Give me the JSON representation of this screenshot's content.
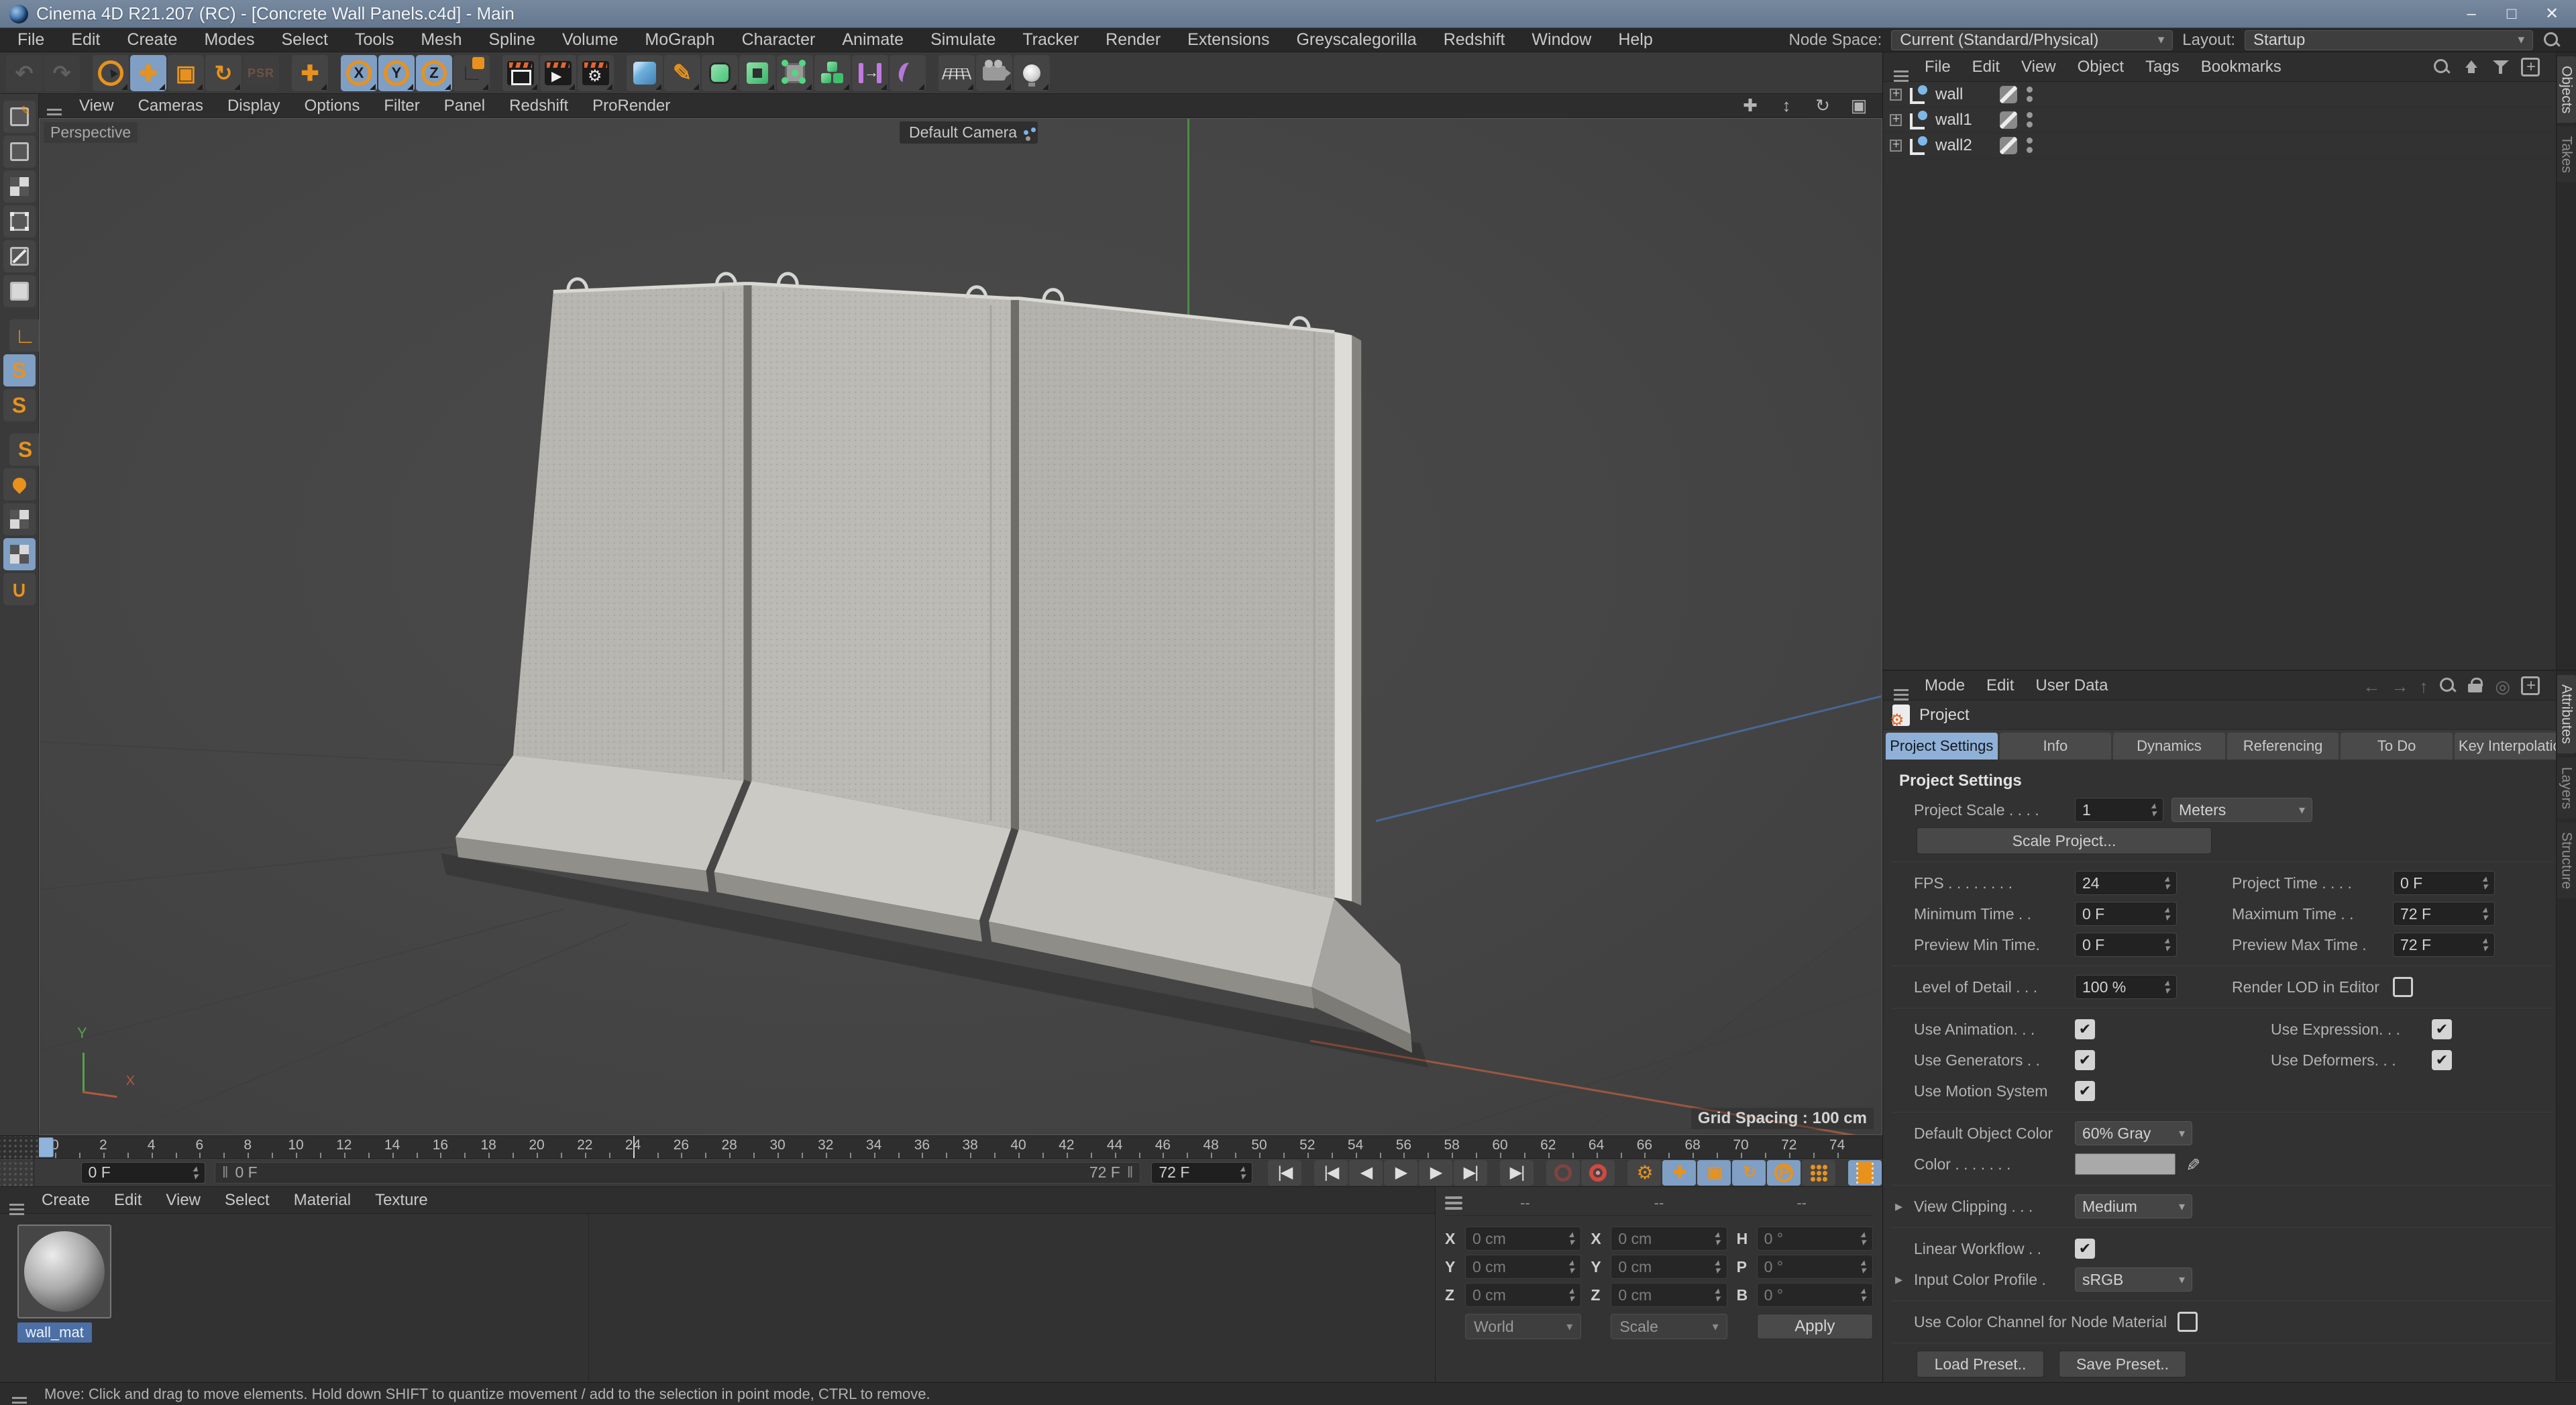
{
  "window": {
    "title": "Cinema 4D R21.207 (RC) - [Concrete Wall Panels.c4d] - Main",
    "minimize": "–",
    "maximize": "□",
    "close": "✕"
  },
  "menubar": {
    "items": [
      "File",
      "Edit",
      "Create",
      "Modes",
      "Select",
      "Tools",
      "Mesh",
      "Spline",
      "Volume",
      "MoGraph",
      "Character",
      "Animate",
      "Simulate",
      "Tracker",
      "Render",
      "Extensions",
      "Greyscalegorilla",
      "Redshift",
      "Window",
      "Help"
    ],
    "node_space_label": "Node Space:",
    "node_space_value": "Current (Standard/Physical)",
    "layout_label": "Layout:",
    "layout_value": "Startup"
  },
  "toolbar": {
    "tools": [
      {
        "name": "undo",
        "icon": "undo-icon",
        "dim": true
      },
      {
        "name": "redo",
        "icon": "redo-icon",
        "dim": true
      },
      {
        "name": "live-selection",
        "icon": "cursor-icon",
        "gap": true
      },
      {
        "name": "move",
        "icon": "move-icon",
        "active": true
      },
      {
        "name": "scale",
        "icon": "scale-icon"
      },
      {
        "name": "rotate",
        "icon": "rotate-icon"
      },
      {
        "name": "psr-keyframe",
        "icon": "psr-icon",
        "dim": true
      },
      {
        "name": "last-tool-move",
        "icon": "move-icon",
        "gap": true
      },
      {
        "name": "lock-x-axis",
        "icon": "x-axis-icon",
        "active": true,
        "gap": true
      },
      {
        "name": "lock-y-axis",
        "icon": "y-axis-icon",
        "active": true
      },
      {
        "name": "lock-z-axis",
        "icon": "z-axis-icon",
        "active": true
      },
      {
        "name": "coordinate-system",
        "icon": "coord-icon"
      },
      {
        "name": "render-view",
        "icon": "render-view-icon",
        "gap": true
      },
      {
        "name": "render-picture-viewer",
        "icon": "render-pv-icon"
      },
      {
        "name": "render-settings",
        "icon": "render-settings-icon"
      },
      {
        "name": "add-cube-primitive",
        "icon": "cube-icon",
        "gap": true
      },
      {
        "name": "pen-spline",
        "icon": "pen-icon"
      },
      {
        "name": "subdivision-surface",
        "icon": "subdiv-icon"
      },
      {
        "name": "extrude-generator",
        "icon": "extrude-icon"
      },
      {
        "name": "ffd-deformer",
        "icon": "ffd-icon"
      },
      {
        "name": "volume-builder",
        "icon": "volume-icon"
      },
      {
        "name": "cloner",
        "icon": "cloner-icon"
      },
      {
        "name": "bend-deformer",
        "icon": "bend-icon"
      },
      {
        "name": "floor-object",
        "icon": "floor-icon",
        "gap": true
      },
      {
        "name": "camera-object",
        "icon": "camera-icon"
      },
      {
        "name": "light-object",
        "icon": "light-icon"
      }
    ]
  },
  "sidebar": {
    "tools": [
      {
        "name": "make-editable",
        "icon": "make-editable-icon"
      },
      {
        "name": "model-mode",
        "icon": "model-mode-icon"
      },
      {
        "name": "texture-mode",
        "icon": "texture-mode-icon"
      },
      {
        "name": "point-mode",
        "icon": "point-mode-icon"
      },
      {
        "name": "edge-mode",
        "icon": "edge-mode-icon"
      },
      {
        "name": "polygon-mode",
        "icon": "polygon-mode-icon"
      },
      {
        "name": "workplane-mode",
        "icon": "workplane-icon",
        "gap": true
      },
      {
        "name": "enable-axis",
        "icon": "snap-icon",
        "active": true
      },
      {
        "name": "snap",
        "icon": "snap-icon"
      },
      {
        "name": "quantize",
        "icon": "quantize-icon",
        "gap": true
      },
      {
        "name": "paint-setup",
        "icon": "paint-icon"
      },
      {
        "name": "texture-paint",
        "icon": "checker-icon"
      },
      {
        "name": "uv-mode",
        "icon": "checker-icon",
        "active": true
      },
      {
        "name": "magnet",
        "icon": "magnet-icon"
      }
    ]
  },
  "viewport": {
    "menu": [
      "View",
      "Cameras",
      "Display",
      "Options",
      "Filter",
      "Panel",
      "Redshift",
      "ProRender"
    ],
    "view_label": "Perspective",
    "camera_label": "Default Camera",
    "grid_spacing_label": "Grid Spacing : 100 cm",
    "axis_y": "Y",
    "axis_x": "X"
  },
  "object_manager": {
    "menu": [
      "File",
      "Edit",
      "View",
      "Object",
      "Tags",
      "Bookmarks"
    ],
    "side_tabs": [
      "Objects",
      "Takes"
    ],
    "objects": [
      {
        "name": "wall"
      },
      {
        "name": "wall1"
      },
      {
        "name": "wall2"
      }
    ]
  },
  "attributes": {
    "menu": [
      "Mode",
      "Edit",
      "User Data"
    ],
    "side_tabs": [
      "Attributes",
      "Layers",
      "Structure"
    ],
    "breadcrumb": "Project",
    "tabs": [
      "Project Settings",
      "Info",
      "Dynamics",
      "Referencing",
      "To Do",
      "Key Interpolation"
    ],
    "active_tab": "Project Settings",
    "section_title": "Project Settings",
    "project_scale": {
      "label": "Project Scale . . . .",
      "value": "1",
      "unit": "Meters"
    },
    "scale_project_button": "Scale Project...",
    "fps": {
      "label": "FPS . . . . . . . .",
      "value": "24"
    },
    "project_time": {
      "label": "Project Time . . . .",
      "value": "0 F"
    },
    "minimum_time": {
      "label": "Minimum Time . .",
      "value": "0 F"
    },
    "maximum_time": {
      "label": "Maximum Time . .",
      "value": "72 F"
    },
    "preview_min_time": {
      "label": "Preview Min Time.",
      "value": "0 F"
    },
    "preview_max_time": {
      "label": "Preview Max Time .",
      "value": "72 F"
    },
    "level_of_detail": {
      "label": "Level of Detail . . .",
      "value": "100 %"
    },
    "render_lod": {
      "label": "Render LOD in Editor",
      "checked": false
    },
    "use_animation": {
      "label": "Use Animation. . .",
      "checked": true
    },
    "use_expression": {
      "label": "Use Expression. . .",
      "checked": true
    },
    "use_generators": {
      "label": "Use Generators . .",
      "checked": true
    },
    "use_deformers": {
      "label": "Use Deformers. . .",
      "checked": true
    },
    "use_motion_system": {
      "label": "Use Motion System",
      "checked": true
    },
    "default_object_color": {
      "label": "Default Object Color",
      "value": "60% Gray"
    },
    "color": {
      "label": "Color . . . . . . .",
      "swatch": "#a9a9a9"
    },
    "view_clipping": {
      "label": "View Clipping . . .",
      "value": "Medium"
    },
    "linear_workflow": {
      "label": "Linear Workflow . .",
      "checked": true
    },
    "input_color_profile": {
      "label": "Input Color Profile .",
      "value": "sRGB"
    },
    "use_color_channel": {
      "label": "Use Color Channel for Node Material",
      "checked": false
    },
    "load_preset_button": "Load Preset..",
    "save_preset_button": "Save Preset.."
  },
  "timeline": {
    "start": 0,
    "end": 74,
    "label_step": 2,
    "playhead": 0,
    "marker": 24,
    "current_frame": "0 F",
    "scrub_current": "0 F",
    "scrub_end": "72 F",
    "end_frame": "72 F",
    "transport": [
      {
        "name": "goto-start",
        "icon": "goto-start-icon"
      },
      {
        "name": "goto-prev-key",
        "icon": "prev-key-icon",
        "gap": true
      },
      {
        "name": "prev-frame",
        "icon": "prev-frame-icon"
      },
      {
        "name": "play",
        "icon": "play-icon"
      },
      {
        "name": "next-frame",
        "icon": "next-frame-icon"
      },
      {
        "name": "goto-next-key",
        "icon": "next-key-icon"
      },
      {
        "name": "goto-end",
        "icon": "goto-end-icon",
        "gap": true
      },
      {
        "name": "autokeying",
        "icon": "key-icon",
        "gap": true
      },
      {
        "name": "record-keyframe",
        "icon": "record-icon"
      },
      {
        "name": "keyframe-selection",
        "icon": "gear-icon",
        "orange": true,
        "gap": true
      },
      {
        "name": "key-position",
        "icon": "move-icon",
        "active": true
      },
      {
        "name": "key-scale",
        "icon": "scale-icon",
        "active": true
      },
      {
        "name": "key-rotation",
        "icon": "rotate-icon",
        "active": true
      },
      {
        "name": "key-parameter",
        "icon": "parameter-icon",
        "active": true
      },
      {
        "name": "key-point-level",
        "icon": "point-level-icon"
      },
      {
        "name": "timeline-window",
        "icon": "film-icon",
        "active": true,
        "gap": true
      }
    ]
  },
  "materials": {
    "menu": [
      "Create",
      "Edit",
      "View",
      "Select",
      "Material",
      "Texture"
    ],
    "items": [
      {
        "name": "wall_mat"
      }
    ]
  },
  "coordinates": {
    "headers": [
      "--",
      "--",
      "--"
    ],
    "position": {
      "rows": [
        {
          "axis": "X",
          "value": "0 cm"
        },
        {
          "axis": "Y",
          "value": "0 cm"
        },
        {
          "axis": "Z",
          "value": "0 cm"
        }
      ],
      "mode": "World"
    },
    "scale": {
      "rows": [
        {
          "axis": "X",
          "value": "0 cm"
        },
        {
          "axis": "Y",
          "value": "0 cm"
        },
        {
          "axis": "Z",
          "value": "0 cm"
        }
      ],
      "mode": "Scale"
    },
    "rotation": {
      "rows": [
        {
          "axis": "H",
          "value": "0 °"
        },
        {
          "axis": "P",
          "value": "0 °"
        },
        {
          "axis": "B",
          "value": "0 °"
        }
      ]
    },
    "apply_button": "Apply"
  },
  "statusbar": {
    "text": "Move: Click and drag to move elements. Hold down SHIFT to quantize movement / add to the selection in point mode, CTRL to remove."
  },
  "colors": {
    "accent_orange": "#e8921d",
    "active_tile_blue": "#7f9fc4",
    "active_tab_blue": "#8fb1d8",
    "record_red": "#d24840",
    "axis_green": "#4f9447",
    "axis_blue": "#4a6c9c",
    "axis_red": "#a55a40",
    "titlebar": "#6b7e95"
  }
}
